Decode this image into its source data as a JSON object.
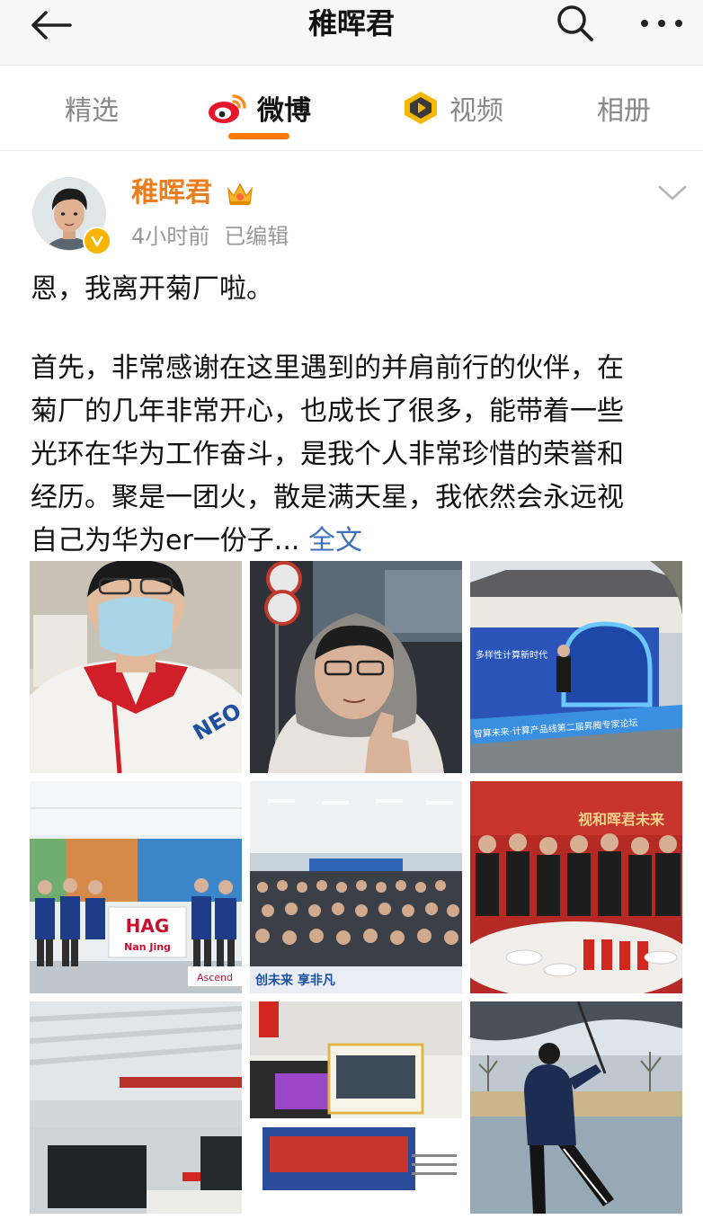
{
  "header": {
    "title": "稚晖君",
    "back_icon": "arrow-left-icon",
    "search_icon": "search-icon",
    "more_icon": "more-dots-icon"
  },
  "tabs": [
    {
      "label": "精选",
      "icon": "",
      "active": false
    },
    {
      "label": "微博",
      "icon": "weibo-logo-icon",
      "active": true
    },
    {
      "label": "视频",
      "icon": "video-play-icon",
      "active": false
    },
    {
      "label": "相册",
      "icon": "",
      "active": false
    }
  ],
  "post": {
    "author": "稚晖君",
    "time": "4小时前",
    "edited": "已编辑",
    "line1": "恩，我离开菊厂啦。",
    "para": [
      "首先，非常感谢在这里遇到的并肩前行的伙伴，在",
      "菊厂的几年非常开心，也成长了很多，能带着一些",
      "光环在华为工作奋斗，是我个人非常珍惜的荣誉和",
      "经历。聚是一团火，散是满天星，我依然会永远视",
      "自己为华为er一份子..."
    ],
    "full_text_link": "全文"
  },
  "photos": {
    "hag_banner": "HAG",
    "hag_sub": "Nan Jing",
    "ascend": "Ascend",
    "neo": "NEO",
    "forum_banner": "智算未来·计算产品线第二届昇腾专家论坛",
    "forum_sub": "多样性计算新时代",
    "event_banner": "创未来 享非凡",
    "dinner_banner": "视和晖君未来"
  },
  "colors": {
    "accent_orange": "#ff7a00",
    "author_orange": "#eb7d1d",
    "link_blue": "#3d6fbf",
    "weibo_red": "#e6162d"
  }
}
